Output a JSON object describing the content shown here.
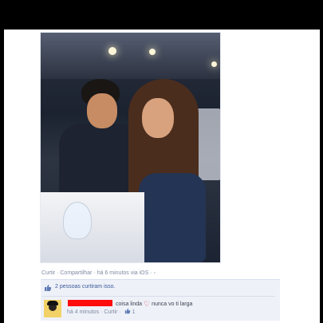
{
  "post": {
    "action_links": [
      "Curtir",
      "Compartilhar"
    ],
    "separator": "·",
    "time_via": "há 6 minutos via iOS",
    "globe_icon": "globe-icon"
  },
  "likes": {
    "text": "2 pessoas curtiram isso.",
    "icon": "thumbs-up-icon"
  },
  "comment": {
    "redacted_name": true,
    "text_before": "coisa linda",
    "emoji": "heart-icon",
    "text_after": "nunca vo ti larga",
    "time": "há 4 minutos",
    "like_link": "Curtir",
    "like_count": "1"
  },
  "colors": {
    "link": "#3b5998",
    "meta": "#7f8aa3",
    "redaction": "#ff0d0d"
  }
}
